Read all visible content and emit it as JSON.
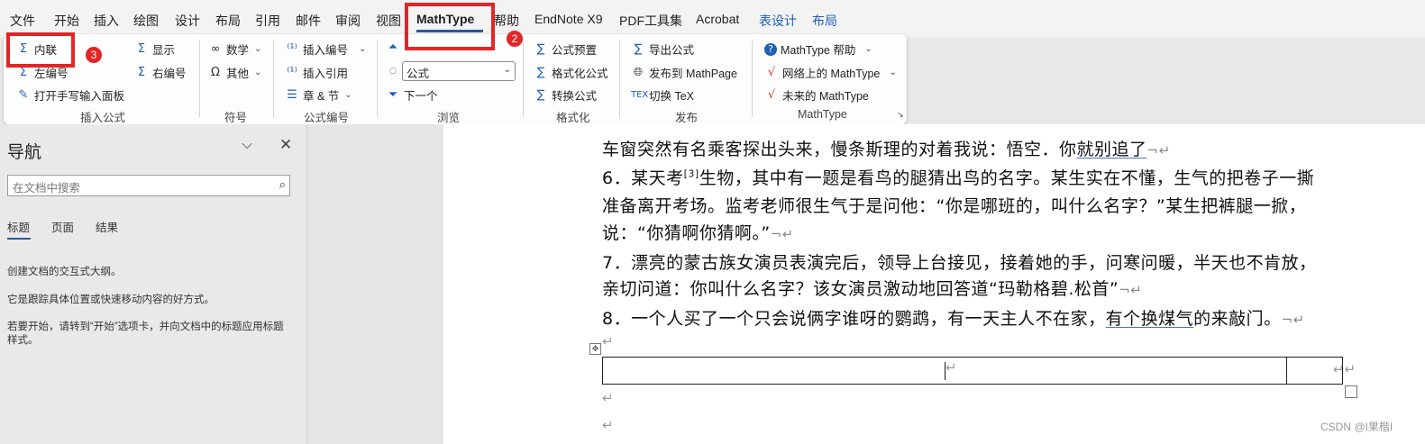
{
  "tabs": [
    "文件",
    "开始",
    "插入",
    "绘图",
    "设计",
    "布局",
    "引用",
    "邮件",
    "审阅",
    "视图",
    "MathType",
    "帮助",
    "EndNote X9",
    "PDF工具集",
    "Acrobat",
    "表设计",
    "布局"
  ],
  "ribbon": {
    "insert_equation": {
      "inline": "内联",
      "display": "显示",
      "left_number": "左编号",
      "right_number": "右编号",
      "handwriting": "打开手写输入面板",
      "group_label": "插入公式"
    },
    "symbols": {
      "math": "数学",
      "other": "其他",
      "group_label": "符号"
    },
    "equation_numbers": {
      "insert_number": "插入编号",
      "insert_reference": "插入引用",
      "chapter_section": "章 & 节",
      "group_label": "公式编号"
    },
    "browse": {
      "style_value": "公式",
      "next": "下一个",
      "group_label": "浏览"
    },
    "format": {
      "equation_preset": "公式预置",
      "format_equations": "格式化公式",
      "convert_equations": "转换公式",
      "group_label": "格式化"
    },
    "publish": {
      "export_equations": "导出公式",
      "publish_mathpage": "发布到 MathPage",
      "toggle_tex": "切换 TeX",
      "group_label": "发布"
    },
    "mathtype": {
      "help": "MathType 帮助",
      "online": "网络上的 MathType",
      "future": "未来的 MathType",
      "group_label": "MathType"
    }
  },
  "badges": [
    "1",
    "2",
    "3"
  ],
  "nav": {
    "title": "导航",
    "search_placeholder": "在文档中搜索",
    "tabs": [
      "标题",
      "页面",
      "结果"
    ],
    "text1": "创建文档的交互式大纲。",
    "text2": "它是跟踪具体位置或快速移动内容的好方式。",
    "text3": "若要开始，请转到“开始”选项卡，并向文档中的标题应用标题样式。"
  },
  "document": {
    "line1a": "车窗突然有名乘客探出头来，慢条斯理的对着我说：悟空．你",
    "line1b": "就别追了",
    "line2a": "6．某天考",
    "line2sup": "[3]",
    "line2b": "生物，其中有一题是看鸟的腿猜出鸟的名字。某生实在不懂，生气的把卷子一撕",
    "line3": "准备离开考场。监考老师很生气于是问他：“你是哪班的，叫什么名字？”某生把裤腿一掀，",
    "line4": "说：“你猜啊你猜啊。”",
    "line5": "7．漂亮的蒙古族女演员表演完后，领导上台接见，接着她的手，问寒问暖，半天也不肯放，",
    "line6": "亲切问道：你叫什么名字？该女演员激动地回答道“玛勒格碧.松首”",
    "line7a": "8．一个人买了一个只会说俩字谁呀的鹦鹉，有一天主人不在家，",
    "line7b": "有个换煤气",
    "line7c": "的来敲门。",
    "watermark": "CSDN @I果楷I"
  },
  "colors": {
    "accent": "#2b579a",
    "highlight": "#e02626"
  }
}
